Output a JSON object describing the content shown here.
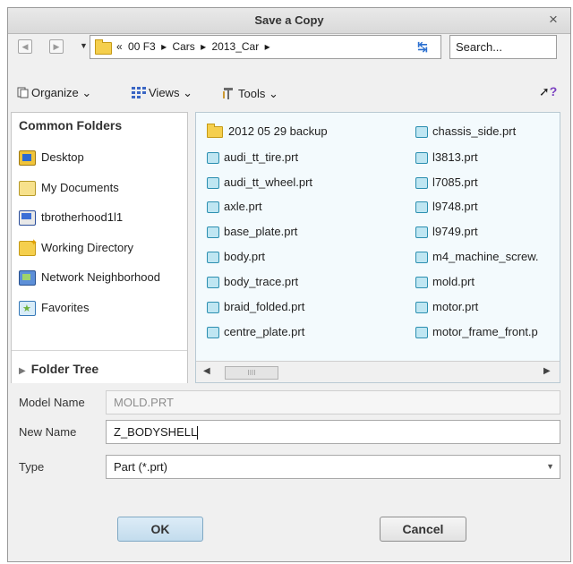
{
  "dialog": {
    "title": "Save a Copy",
    "close_glyph": "×"
  },
  "address": {
    "crumbs": [
      "«",
      "00 F3",
      "▸",
      "Cars",
      "▸",
      "2013_Car",
      "▸"
    ],
    "search_placeholder": "Search..."
  },
  "toolbar": {
    "organize": "Organize",
    "views": "Views",
    "tools": "Tools"
  },
  "sidebar": {
    "heading": "Common Folders",
    "items": [
      {
        "label": "Desktop",
        "icon": "desktop-icon"
      },
      {
        "label": "My Documents",
        "icon": "my-documents-icon"
      },
      {
        "label": "tbrotherhood1l1",
        "icon": "computer-icon"
      },
      {
        "label": "Working Directory",
        "icon": "working-directory-icon"
      },
      {
        "label": "Network Neighborhood",
        "icon": "network-icon"
      },
      {
        "label": "Favorites",
        "icon": "favorites-icon"
      }
    ],
    "folder_tree": "Folder Tree"
  },
  "files": {
    "col1": [
      "2012 05 29 backup",
      "audi_tt_tire.prt",
      "audi_tt_wheel.prt",
      "axle.prt",
      "base_plate.prt",
      "body.prt",
      "body_trace.prt",
      "braid_folded.prt",
      "centre_plate.prt"
    ],
    "col2": [
      "chassis_side.prt",
      "l3813.prt",
      "l7085.prt",
      "l9748.prt",
      "l9749.prt",
      "m4_machine_screw.",
      "mold.prt",
      "motor.prt",
      "motor_frame_front.p"
    ]
  },
  "form": {
    "model_name_label": "Model Name",
    "model_name_value": "MOLD.PRT",
    "new_name_label": "New Name",
    "new_name_value": "Z_BODYSHELL",
    "type_label": "Type",
    "type_value": "Part (*.prt)"
  },
  "buttons": {
    "ok": "OK",
    "cancel": "Cancel"
  },
  "colors": {
    "accent": "#2b8fb0",
    "folder": "#f5cf4d",
    "ok_button": "#c3dced"
  }
}
